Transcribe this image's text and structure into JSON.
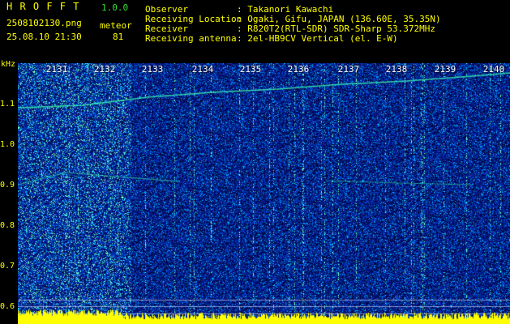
{
  "header": {
    "app_name": "H R O F F T",
    "version": "1.0.0",
    "filename": "2508102130.png",
    "mode": "meteor",
    "datetime": "25.08.10 21:30",
    "count": "81",
    "fields": [
      {
        "label": "Observer",
        "value": ": Takanori Kawachi"
      },
      {
        "label": "Receiving Location",
        "value": ": Ogaki, Gifu, JAPAN (136.60E, 35.35N)"
      },
      {
        "label": "Receiver",
        "value": ": R820T2(RTL-SDR) SDR-Sharp 53.372MHz"
      },
      {
        "label": "Receiving antenna",
        "value": ": 2el-HB9CV Vertical (el. E-W)"
      }
    ]
  },
  "axes": {
    "y_unit": "kHz",
    "y_ticks": [
      "1.1",
      "1.0",
      "0.9",
      "0.8",
      "0.7",
      "0.6"
    ],
    "x_ticks": [
      "2131",
      "2132",
      "2133",
      "2134",
      "2135",
      "2136",
      "2137",
      "2138",
      "2139",
      "2140"
    ]
  },
  "colors": {
    "background": "#000000",
    "header_text": "#ffff00",
    "spectrogram_base": "#0a1e8c",
    "signal": "#22ffaa",
    "noise_bar": "#ffff00"
  }
}
